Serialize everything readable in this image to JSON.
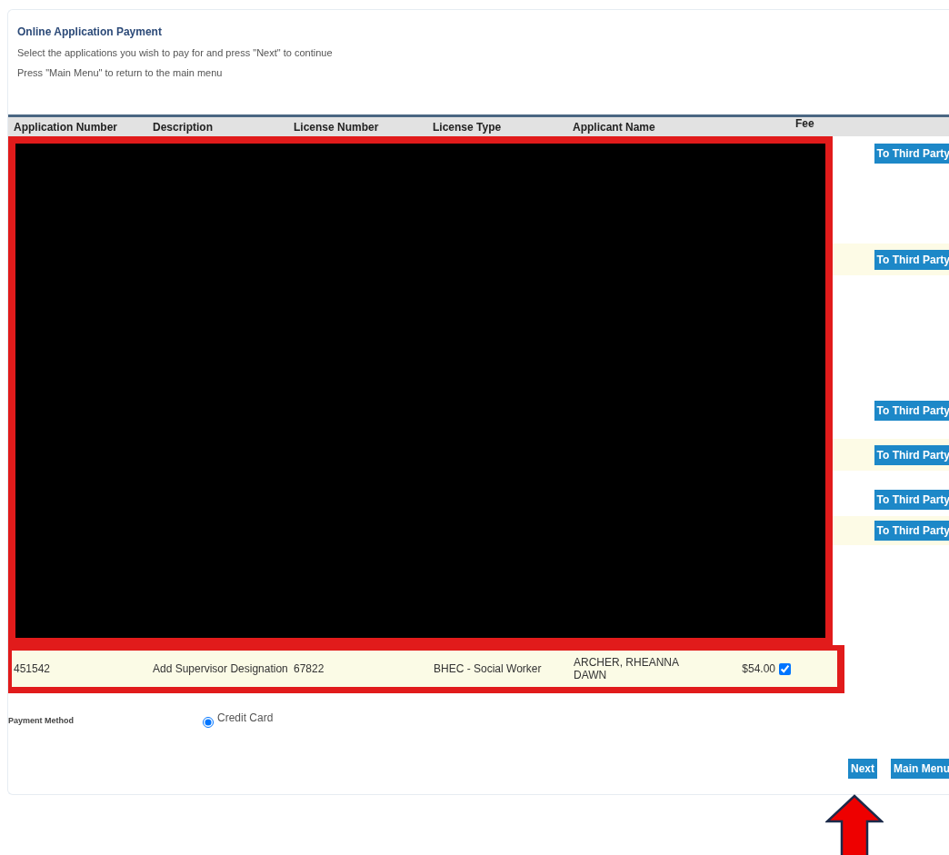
{
  "title": "Online Application Payment",
  "instructions": [
    "Select the applications you wish to pay for and press \"Next\" to continue",
    "Press \"Main Menu\" to return to the main menu"
  ],
  "table": {
    "columns": [
      "Application Number",
      "Description",
      "License Number",
      "License Type",
      "Applicant Name",
      "Fee"
    ],
    "third_party_rows": [
      {
        "button": "To Third Party",
        "highlighted": false
      },
      {
        "button": "To Third Party",
        "highlighted": true
      },
      {
        "button": "To Third Party",
        "highlighted": false
      },
      {
        "button": "To Third Party",
        "highlighted": true
      },
      {
        "button": "To Third Party",
        "highlighted": false
      },
      {
        "button": "To Third Party",
        "highlighted": true
      }
    ],
    "rows": [
      {
        "cells": [
          "451542",
          "Add Supervisor Designation",
          "67822",
          "BHEC - Social Worker",
          "ARCHER, RHEANNA DAWN",
          "$54.00"
        ],
        "checked": true
      }
    ]
  },
  "payment_method": {
    "label": "Payment Method",
    "options": [
      {
        "label": "Credit Card",
        "selected": true
      }
    ]
  },
  "buttons": [
    "Next",
    "Main Menu"
  ]
}
